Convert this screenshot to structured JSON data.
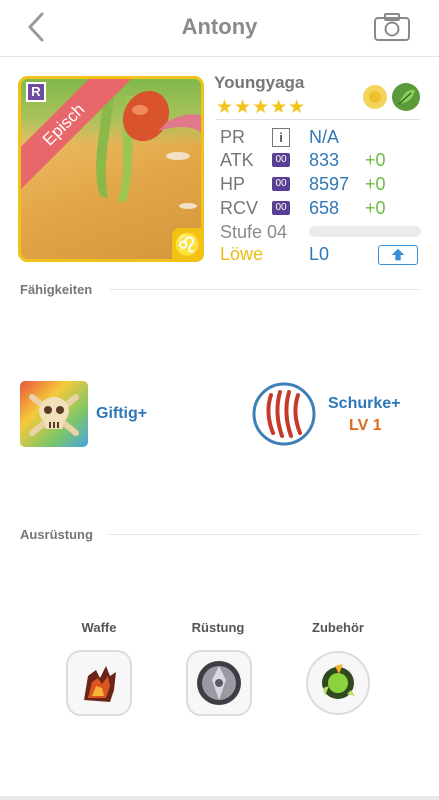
{
  "header": {
    "title": "Antony"
  },
  "card": {
    "rarity_letter": "R",
    "rarity_label": "Episch",
    "zodiac_symbol": "♌",
    "name": "Youngyaga",
    "stars": "★★★★★",
    "star_count": 5
  },
  "stats": {
    "pr": {
      "label": "PR",
      "badge": "i",
      "value": "N/A"
    },
    "atk": {
      "label": "ATK",
      "badge": "00",
      "value": "833",
      "bonus": "+0"
    },
    "hp": {
      "label": "HP",
      "badge": "00",
      "value": "8597",
      "bonus": "+0"
    },
    "rcv": {
      "label": "RCV",
      "badge": "00",
      "value": "658",
      "bonus": "+0"
    },
    "level_label": "Stufe 04",
    "level_progress": 0,
    "zodiac_name": "Löwe",
    "evolution": "L0"
  },
  "sections": {
    "abilities": "Fähigkeiten",
    "equipment": "Ausrüstung"
  },
  "skills": [
    {
      "name": "Giftig+",
      "icon": "poison-skull-icon"
    },
    {
      "name": "Schurke+",
      "level": "LV 1",
      "icon": "claw-slash-icon"
    }
  ],
  "equipment": [
    {
      "label": "Waffe",
      "icon": "flame-gauntlet-icon"
    },
    {
      "label": "Rüstung",
      "icon": "steel-shield-icon"
    },
    {
      "label": "Zubehör",
      "icon": "green-orb-icon"
    }
  ],
  "colors": {
    "accent_blue": "#2f78b8",
    "bonus_green": "#6cbd3f",
    "gold": "#f4c31b",
    "ribbon": "#e8676b",
    "skill_level": "#e0691a"
  }
}
